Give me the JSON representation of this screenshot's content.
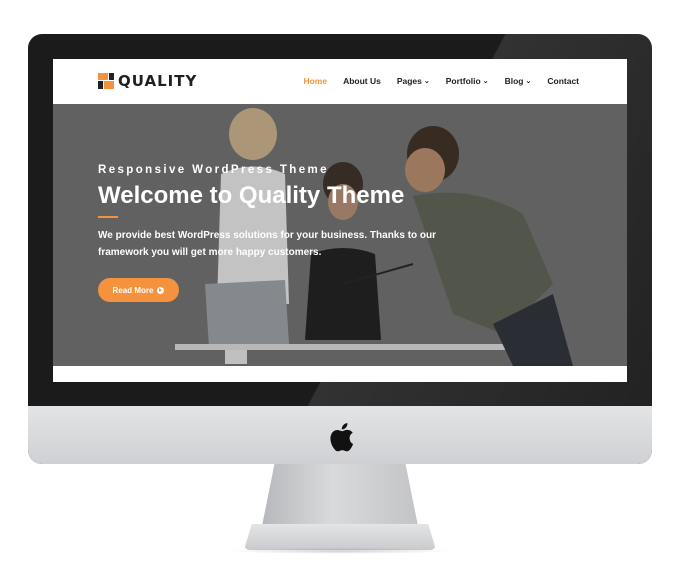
{
  "brand": {
    "name": "QUALITY",
    "accent": "#f5923e"
  },
  "nav": {
    "items": [
      {
        "label": "Home",
        "active": true,
        "dropdown": false
      },
      {
        "label": "About Us",
        "active": false,
        "dropdown": false
      },
      {
        "label": "Pages",
        "active": false,
        "dropdown": true
      },
      {
        "label": "Portfolio",
        "active": false,
        "dropdown": true
      },
      {
        "label": "Blog",
        "active": false,
        "dropdown": true
      },
      {
        "label": "Contact",
        "active": false,
        "dropdown": false
      }
    ],
    "caret": "⌄"
  },
  "hero": {
    "subtitle": "Responsive WordPress Theme",
    "title": "Welcome to Quality Theme",
    "description": "We provide best WordPress solutions for your business. Thanks to our framework you will get more happy customers.",
    "button_label": "Read More"
  },
  "icons": {
    "apple": "apple-logo-icon",
    "button": "chevron-circle-right-icon"
  }
}
